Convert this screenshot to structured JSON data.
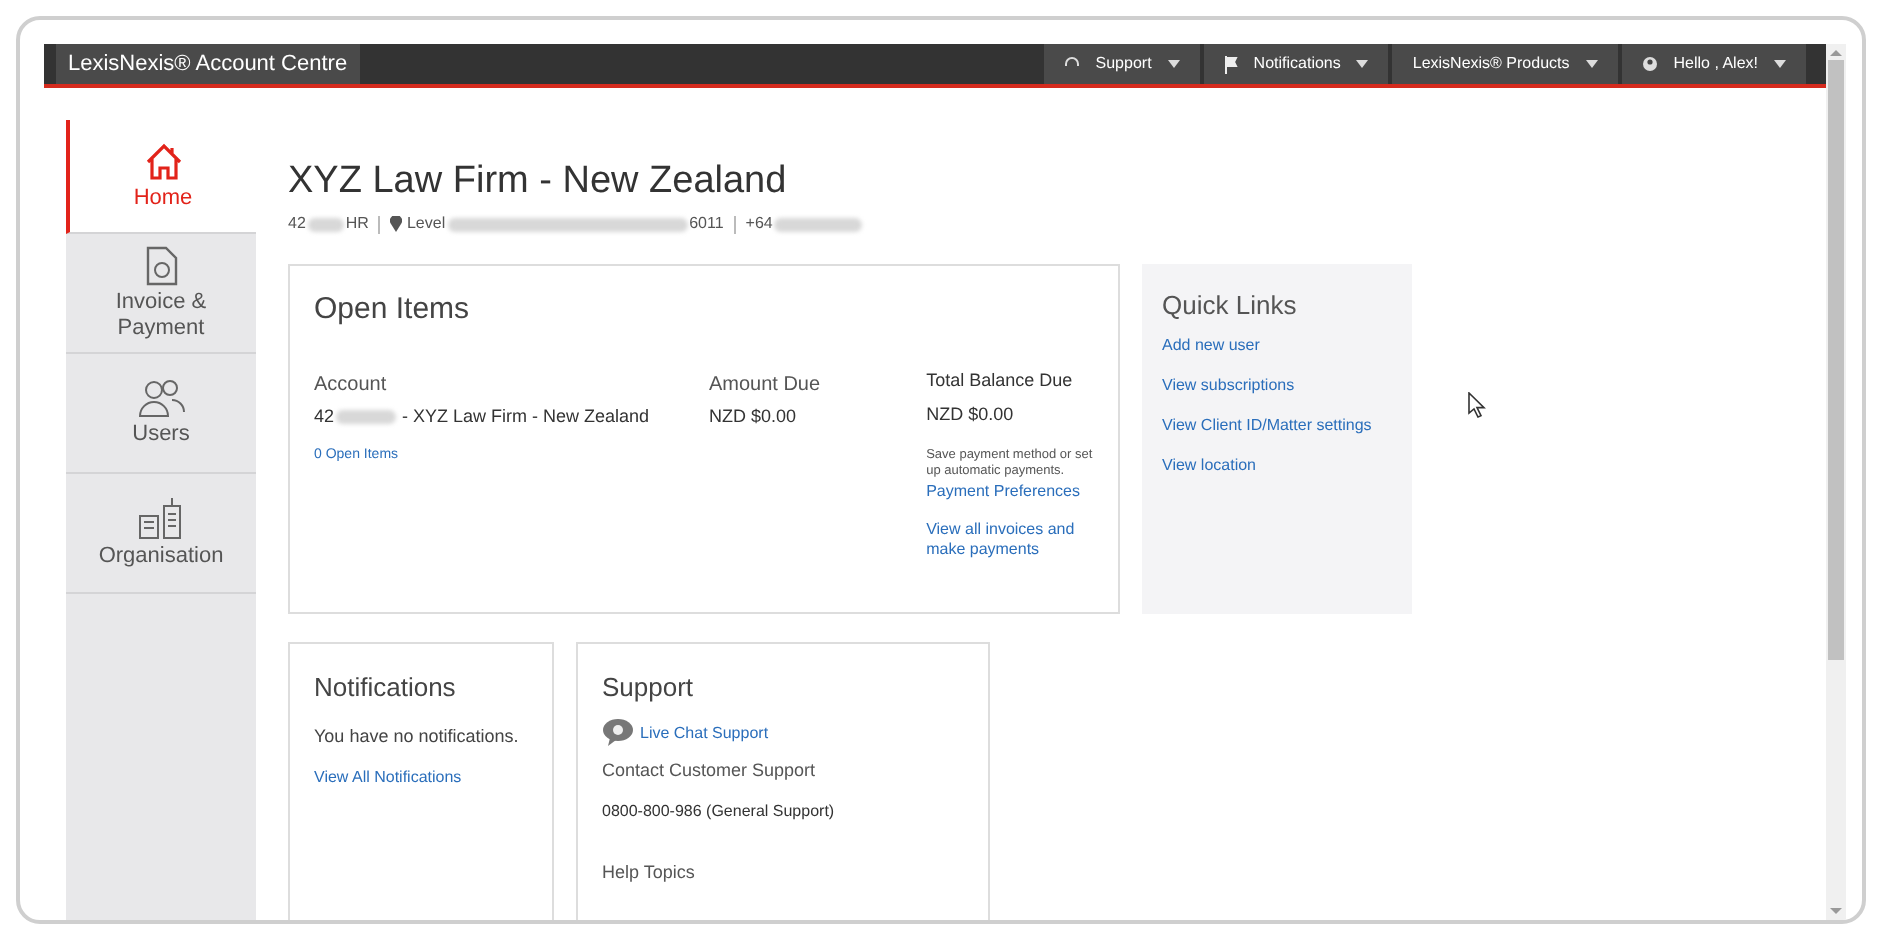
{
  "top_bar": {
    "brand": "LexisNexis® Account Centre",
    "menus": [
      {
        "kind": "support",
        "label": "Support"
      },
      {
        "kind": "flag",
        "label": "Notifications"
      },
      {
        "kind": "none",
        "label": "LexisNexis® Products"
      },
      {
        "kind": "user",
        "label": "Hello , Alex!"
      }
    ]
  },
  "sidebar": {
    "items": [
      {
        "kind": "home",
        "label": "Home",
        "selected": true
      },
      {
        "kind": "invoice",
        "label": "Invoice & Payment",
        "selected": false
      },
      {
        "kind": "users",
        "label": "Users",
        "selected": false
      },
      {
        "kind": "organisation",
        "label": "Organisation",
        "selected": false
      }
    ]
  },
  "firm": {
    "title": "XYZ Law Firm - New Zealand",
    "account_prefix": "42",
    "account_suffix": "HR",
    "address_prefix": "Level",
    "address_suffix": "6011",
    "phone_prefix": "+64"
  },
  "open_items": {
    "title": "Open Items",
    "account_heading": "Account",
    "account_prefix": "42",
    "account_name": "- XYZ Law Firm - New Zealand",
    "open_items_link": "0 Open Items",
    "amount_heading": "Amount Due",
    "amount": "NZD $0.00",
    "balance_heading": "Total Balance Due",
    "balance": "NZD $0.00",
    "payment_note": "Save payment method or set up automatic payments.",
    "payment_link": "Payment Preferences",
    "invoices_link": "View all invoices and make payments"
  },
  "quick_links": {
    "title": "Quick Links",
    "links": [
      "Add new user",
      "View subscriptions",
      "View Client ID/Matter settings",
      "View location"
    ]
  },
  "notifications": {
    "title": "Notifications",
    "message": "You have no notifications.",
    "link": "View All Notifications"
  },
  "support": {
    "title": "Support",
    "chat_link": "Live Chat Support",
    "contact_heading": "Contact Customer Support",
    "phone": "0800-800-986 (General Support)",
    "help_heading": "Help Topics"
  }
}
